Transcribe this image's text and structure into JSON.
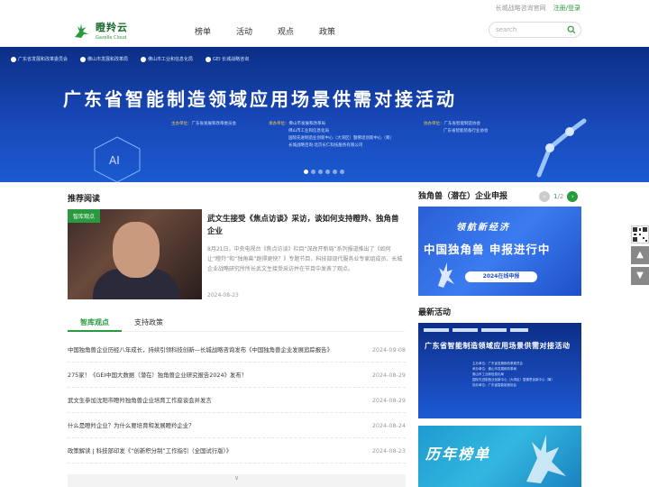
{
  "topbar": {
    "official_site": "长城战略咨询官网",
    "login": "注册/登录"
  },
  "logo": {
    "name": "瞪羚云",
    "subtitle": "Gazelle Cloud"
  },
  "nav": {
    "items": [
      "榜单",
      "活动",
      "观点",
      "政策"
    ]
  },
  "search": {
    "placeholder": "search"
  },
  "banner": {
    "orgs": [
      "广东省发展和改革委员会",
      "佛山市发展和改革局",
      "佛山市工业和信息化局",
      "GEI 长城战略咨询"
    ],
    "title": "广东省智能制造领域应用场景供需对接活动",
    "info_blocks": [
      {
        "label": "主办单位：",
        "lines": [
          "广东省发展和改革委员会"
        ]
      },
      {
        "label": "承办单位：",
        "lines": [
          "佛山市发展和改革局",
          "佛山市工业和信息化局",
          "国际先进制造业创新中心（大湾区）暨佛思创新中心（筹）",
          "长城战略咨询·北京长仁科技服务有限公司"
        ]
      },
      {
        "label": "协办单位：",
        "lines": [
          "广东省智能制造协会",
          "广东省智能装备行业协会"
        ]
      }
    ],
    "slide_count": 6,
    "active_slide": 0
  },
  "recommend": {
    "title": "推荐阅读",
    "tag": "智库观点",
    "headline": "武文生接受《焦点访谈》采访，谈如何支持瞪羚、独角兽企业",
    "desc": "8月21日，中央电视台《焦点访谈》栏目“深改开新局”系列报道推出了《如何让“瞪羚”和“独角兽”跑得更快？》专题节目，科技部现代服务业专家组成员、长城企业战略研究所所长武文生接受采访并在节目中发表了观点。",
    "date": "2024-08-23"
  },
  "tabs": [
    "智库观点",
    "支持政策"
  ],
  "news": [
    {
      "title": "中国独角兽企业历经八年成长，持续引领科技创新—长城战略咨询发布《中国独角兽企业发展追踪报告》",
      "date": "2024-09-08"
    },
    {
      "title": "275家！《GEI中国大数据（潜在）独角兽企业研究报告2024》发布！",
      "date": "2024-08-29"
    },
    {
      "title": "武文生参加沈阳市瞪羚独角兽企业培育工作座谈会并发言",
      "date": "2024-08-29"
    },
    {
      "title": "什么是瞪羚企业？为什么要培育和发展瞪羚企业？",
      "date": "2024-08-24"
    },
    {
      "title": "政策解读 | 科技部印发《“创新积分制”工作指引（全国试行版）》",
      "date": "2024-08-23"
    }
  ],
  "more_icon": "double-chevron-down-icon",
  "unicorn": {
    "title": "独角兽（潜在）企业申报",
    "page": "1",
    "total": "/2",
    "banner_line1": "领航新经济",
    "banner_line2": "中国独角兽 申报进行中",
    "banner_button": "2024在线申报"
  },
  "events": {
    "title": "最新活动",
    "ev1_title": "广东省智能制造领域应用场景供需对接活动",
    "ev2_title": "历年榜单"
  },
  "colors": {
    "brand_green": "#2a9a3e",
    "banner_blue": "#1848b8"
  }
}
